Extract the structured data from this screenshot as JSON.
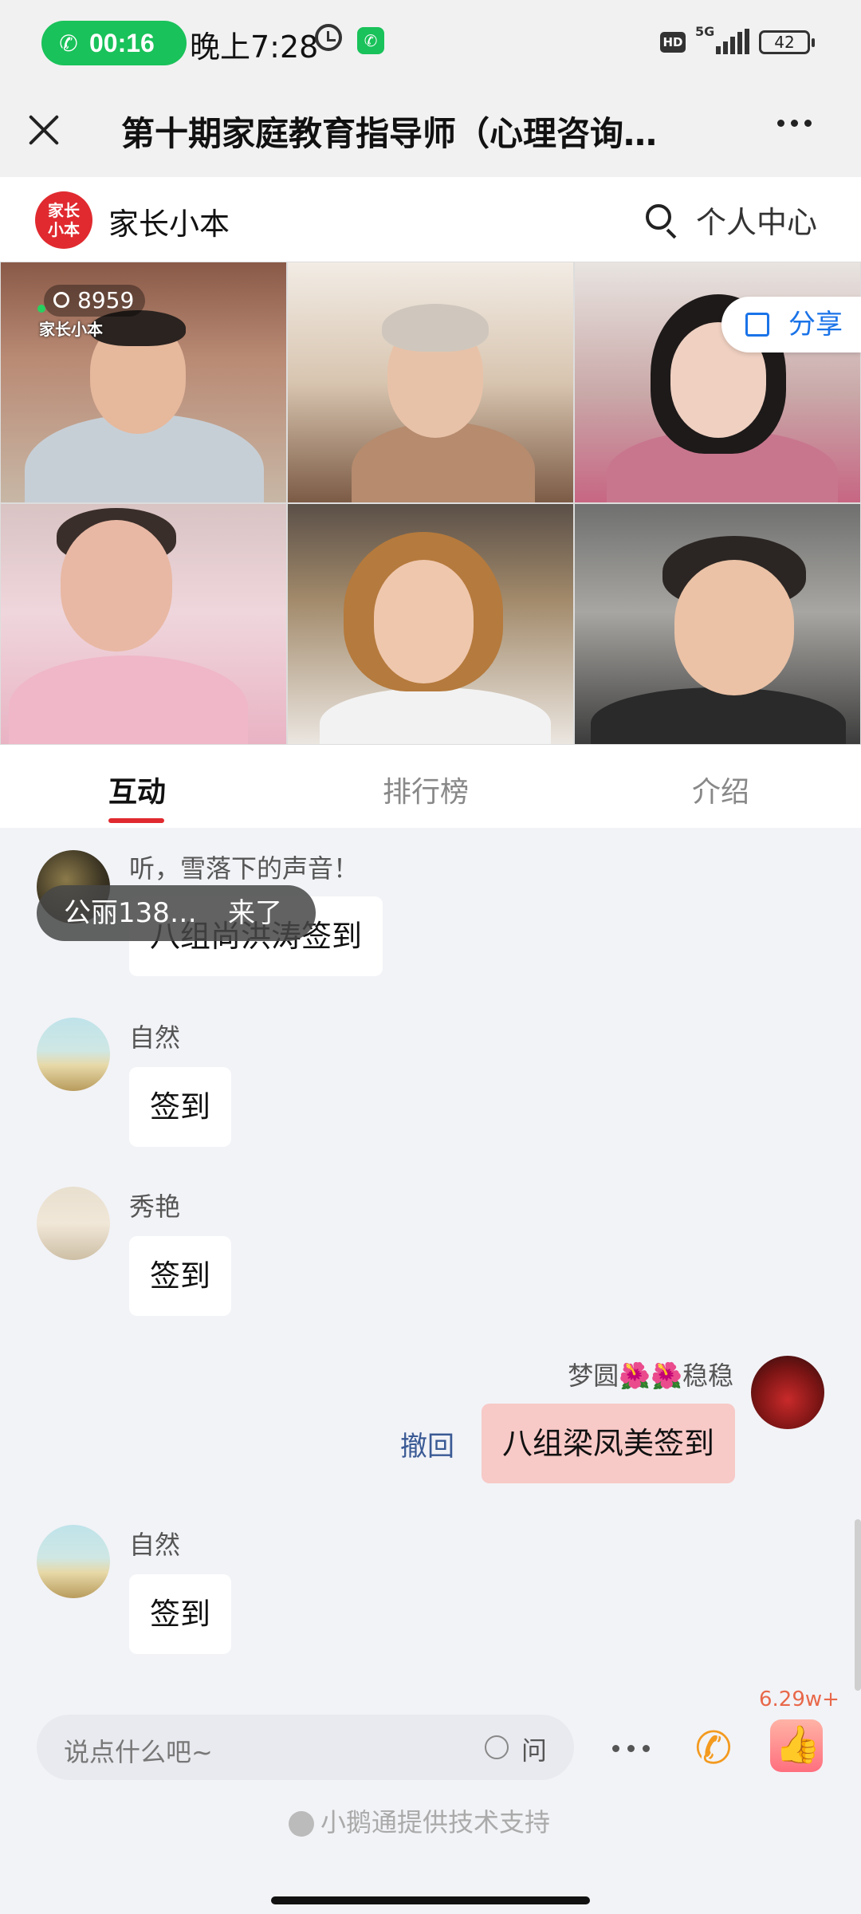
{
  "status_bar": {
    "call_timer": "00:16",
    "time": "晚上7:28",
    "hd": "HD",
    "network": "5G",
    "battery": "42"
  },
  "header": {
    "title": "第十期家庭教育指导师（心理咨询…"
  },
  "brand": {
    "logo_text_line1": "家长",
    "logo_text_line2": "小本",
    "name": "家长小本",
    "personal_center": "个人中心"
  },
  "live": {
    "viewers": "8959",
    "watermark": "家长小本",
    "share_label": "分享"
  },
  "tabs": [
    {
      "label": "互动",
      "active": true
    },
    {
      "label": "排行榜",
      "active": false
    },
    {
      "label": "介绍",
      "active": false
    }
  ],
  "messages": [
    {
      "sender": "听，雪落下的声音！",
      "text": "八组尚洪涛签到",
      "mine": false
    },
    {
      "sender": "自然",
      "text": "签到",
      "mine": false
    },
    {
      "sender": "秀艳",
      "text": "签到",
      "mine": false
    },
    {
      "sender": "梦圆🌺🌺稳稳",
      "text": "八组梁凤美签到",
      "mine": true,
      "recall": "撤回"
    },
    {
      "sender": "自然",
      "text": "签到",
      "mine": false
    }
  ],
  "toast": {
    "name": "公丽138…",
    "action": "来了"
  },
  "bottom": {
    "placeholder": "说点什么吧~",
    "ask": "问",
    "like_count": "6.29w+",
    "powered_by": "小鹅通提供技术支持"
  }
}
